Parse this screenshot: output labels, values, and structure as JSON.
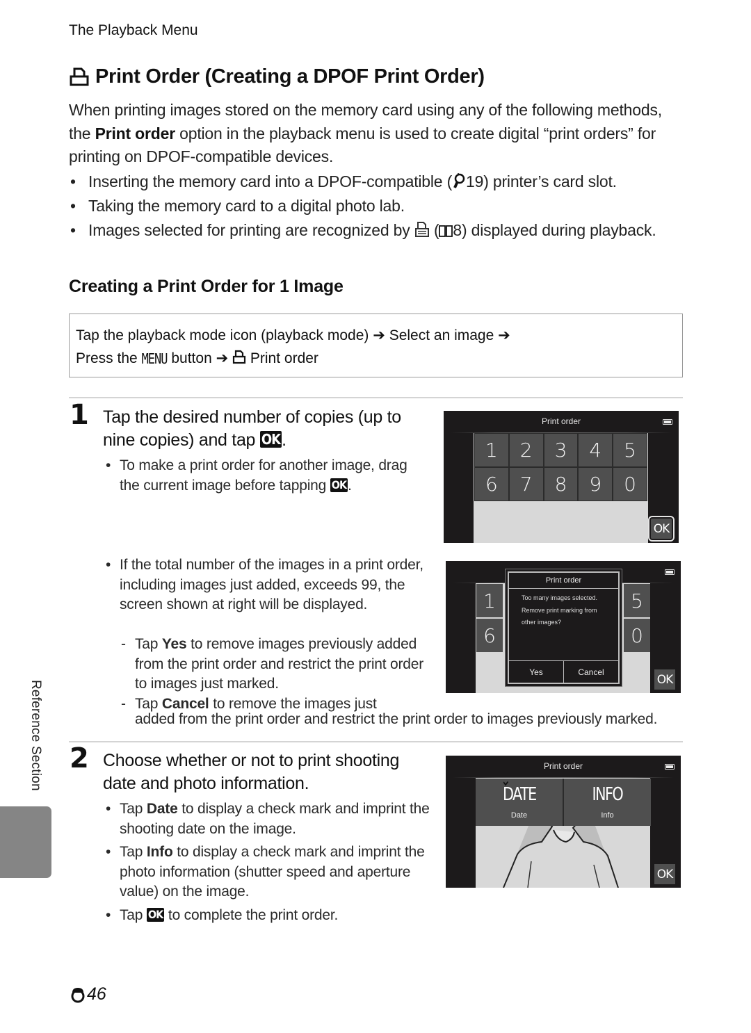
{
  "running_head": "The Playback Menu",
  "title": {
    "icon": "print-order-icon",
    "text": "Print Order (Creating a DPOF Print Order)"
  },
  "intro": {
    "part1": "When printing images stored on the memory card using any of the following methods, the ",
    "bold": "Print order",
    "part2": " option in the playback menu is used to create digital “print orders” for printing on DPOF-compatible devices."
  },
  "bullets": [
    {
      "before": "Inserting the memory card into a DPOF-compatible (",
      "ref_icon": "technical-notes-icon",
      "ref": "19",
      "after": ") printer’s card slot."
    },
    {
      "text": "Taking the memory card to a digital photo lab."
    },
    {
      "before": "Images selected for printing are recognized by ",
      "icon": "print-mark-icon",
      "mid": " (",
      "ref_icon": "book-icon",
      "ref": "8",
      "after": ") displayed during playback."
    }
  ],
  "subheading": "Creating a Print Order for 1 Image",
  "navigation": {
    "line1_a": "Tap the playback mode icon (playback mode)",
    "arrow": "➔",
    "line1_b": "Select an image",
    "line2_a": "Press the",
    "menu_button": "MENU",
    "line2_b": "button",
    "line2_c": "Print order"
  },
  "step1": {
    "number": "1",
    "title_a": "Tap the desired number of copies (up to nine copies) and tap",
    "ok": "OK",
    "bullet1_a": "To make a print order for another image, drag the current image before tapping",
    "bullet2": "If the total number of the images in a print order, including images just added, exceeds 99, the screen shown at right will be displayed.",
    "sub1": {
      "a": "Tap ",
      "bold": "Yes",
      "b": " to remove images previously added from the print order and restrict the print order to images just marked."
    },
    "sub2": {
      "a": "Tap ",
      "bold": "Cancel",
      "b": " to remove the images just"
    },
    "sub2_cont": "added from the print order and restrict the print order to images previously marked."
  },
  "screen1": {
    "title": "Print order",
    "keys": [
      "1",
      "2",
      "3",
      "4",
      "5",
      "6",
      "7",
      "8",
      "9",
      "0"
    ],
    "ok": "OK"
  },
  "screen2": {
    "title": "Print order",
    "keys_left": [
      "1",
      "6"
    ],
    "keys_right": [
      "5",
      "0"
    ],
    "dialog": {
      "title": "Print order",
      "message_lines": [
        "Too many images selected.",
        "Remove print marking from",
        "other images?"
      ],
      "yes": "Yes",
      "cancel": "Cancel"
    },
    "ok": "OK"
  },
  "step2": {
    "number": "2",
    "title": "Choose whether or not to print shooting date and photo information.",
    "b1": {
      "a": "Tap ",
      "bold": "Date",
      "b": " to display a check mark and imprint the shooting date on the image."
    },
    "b2": {
      "a": "Tap ",
      "bold": "Info",
      "b": " to display a check mark and imprint the photo information (shutter speed and aperture value) on the image."
    },
    "b3": {
      "a": "Tap ",
      "ok": "OK",
      "b": " to complete the print order."
    }
  },
  "screen3": {
    "title": "Print order",
    "date_big": "DATE",
    "date_label": "Date",
    "date_checked": true,
    "info_big": "INFO",
    "info_label": "Info",
    "info_checked": false,
    "ok": "OK"
  },
  "side_tab": "Reference Section",
  "page_number": {
    "prefix_icon": "reference-section-icon",
    "number": "46"
  }
}
